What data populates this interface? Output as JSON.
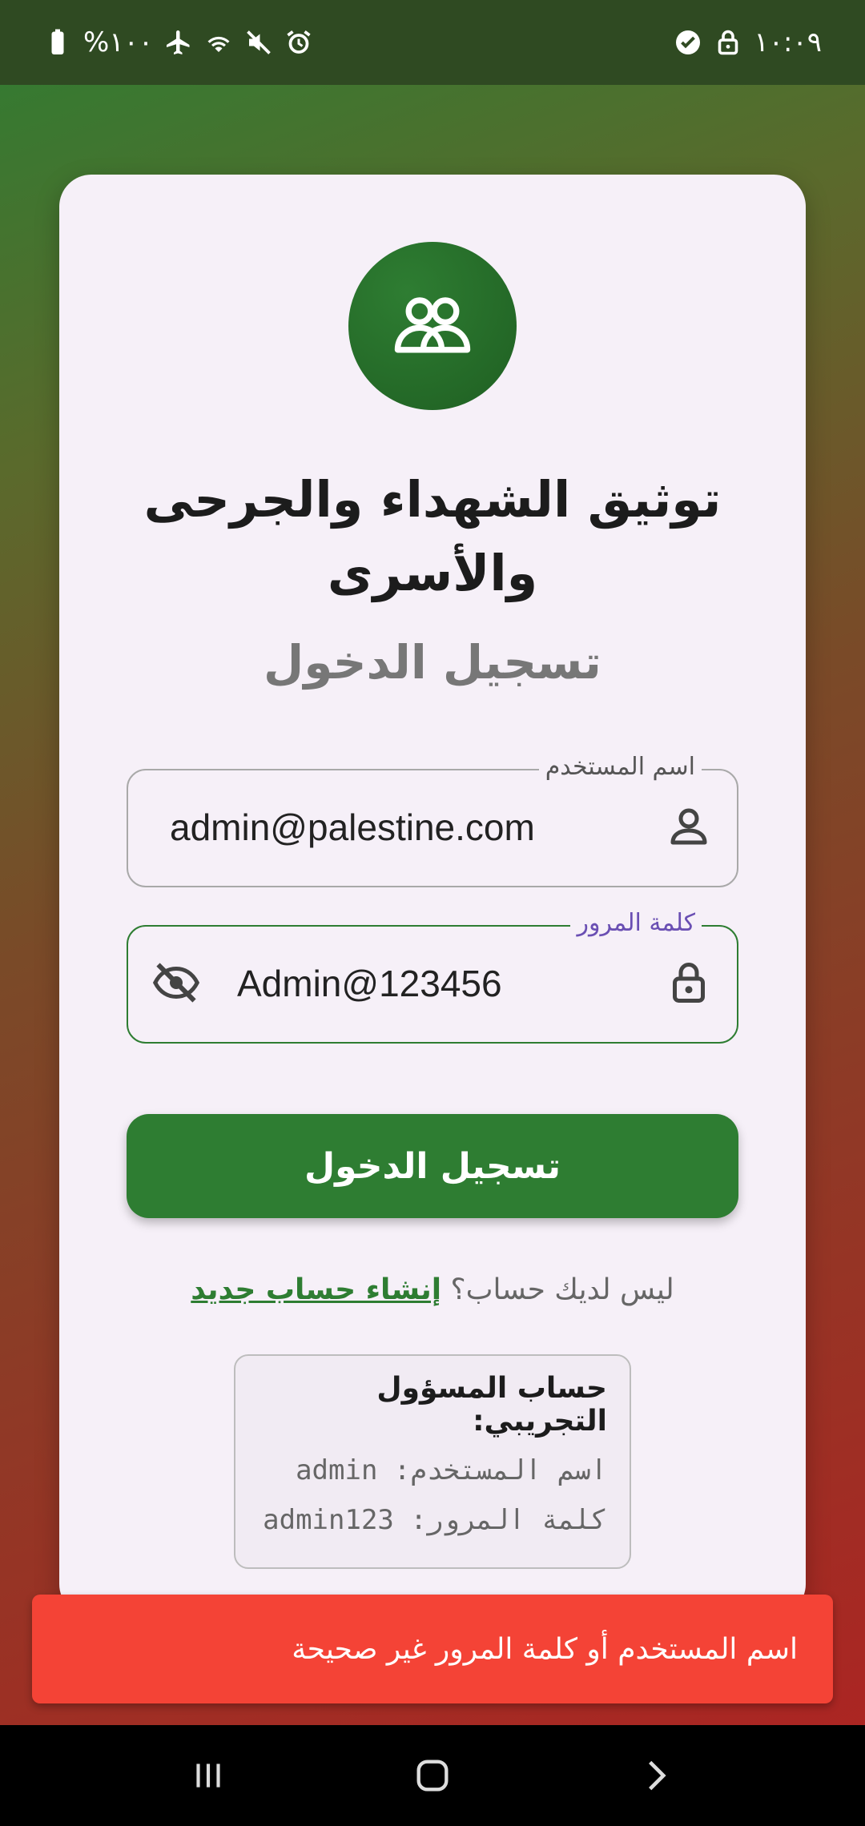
{
  "status_bar": {
    "time": "١٠:٠٩",
    "battery": "%١٠٠",
    "icons_left": [
      "battery-icon",
      "airplane-icon",
      "wifi-icon",
      "mute-icon",
      "alarm-icon"
    ],
    "icons_right": [
      "check-circle-icon",
      "lock-icon"
    ]
  },
  "app": {
    "title": "توثيق الشهداء والجرحى والأسرى",
    "subtitle": "تسجيل الدخول",
    "logo_icon": "people-icon"
  },
  "form": {
    "username_label": "اسم المستخدم",
    "username_value": "admin@palestine.com",
    "password_label": "كلمة المرور",
    "password_value": "Admin@123456",
    "login_button": "تسجيل الدخول"
  },
  "signup": {
    "prompt": "ليس لديك حساب؟",
    "link": "إنشاء حساب جديد"
  },
  "demo_account": {
    "title": "حساب المسؤول التجريبي:",
    "username_line": "اسم المستخدم: admin",
    "password_line": "كلمة المرور: admin123"
  },
  "snackbar": {
    "message": "اسم المستخدم أو كلمة المرور غير صحيحة"
  },
  "colors": {
    "primary": "#2e7d32",
    "error": "#f44336",
    "card": "#f6f0f8"
  }
}
